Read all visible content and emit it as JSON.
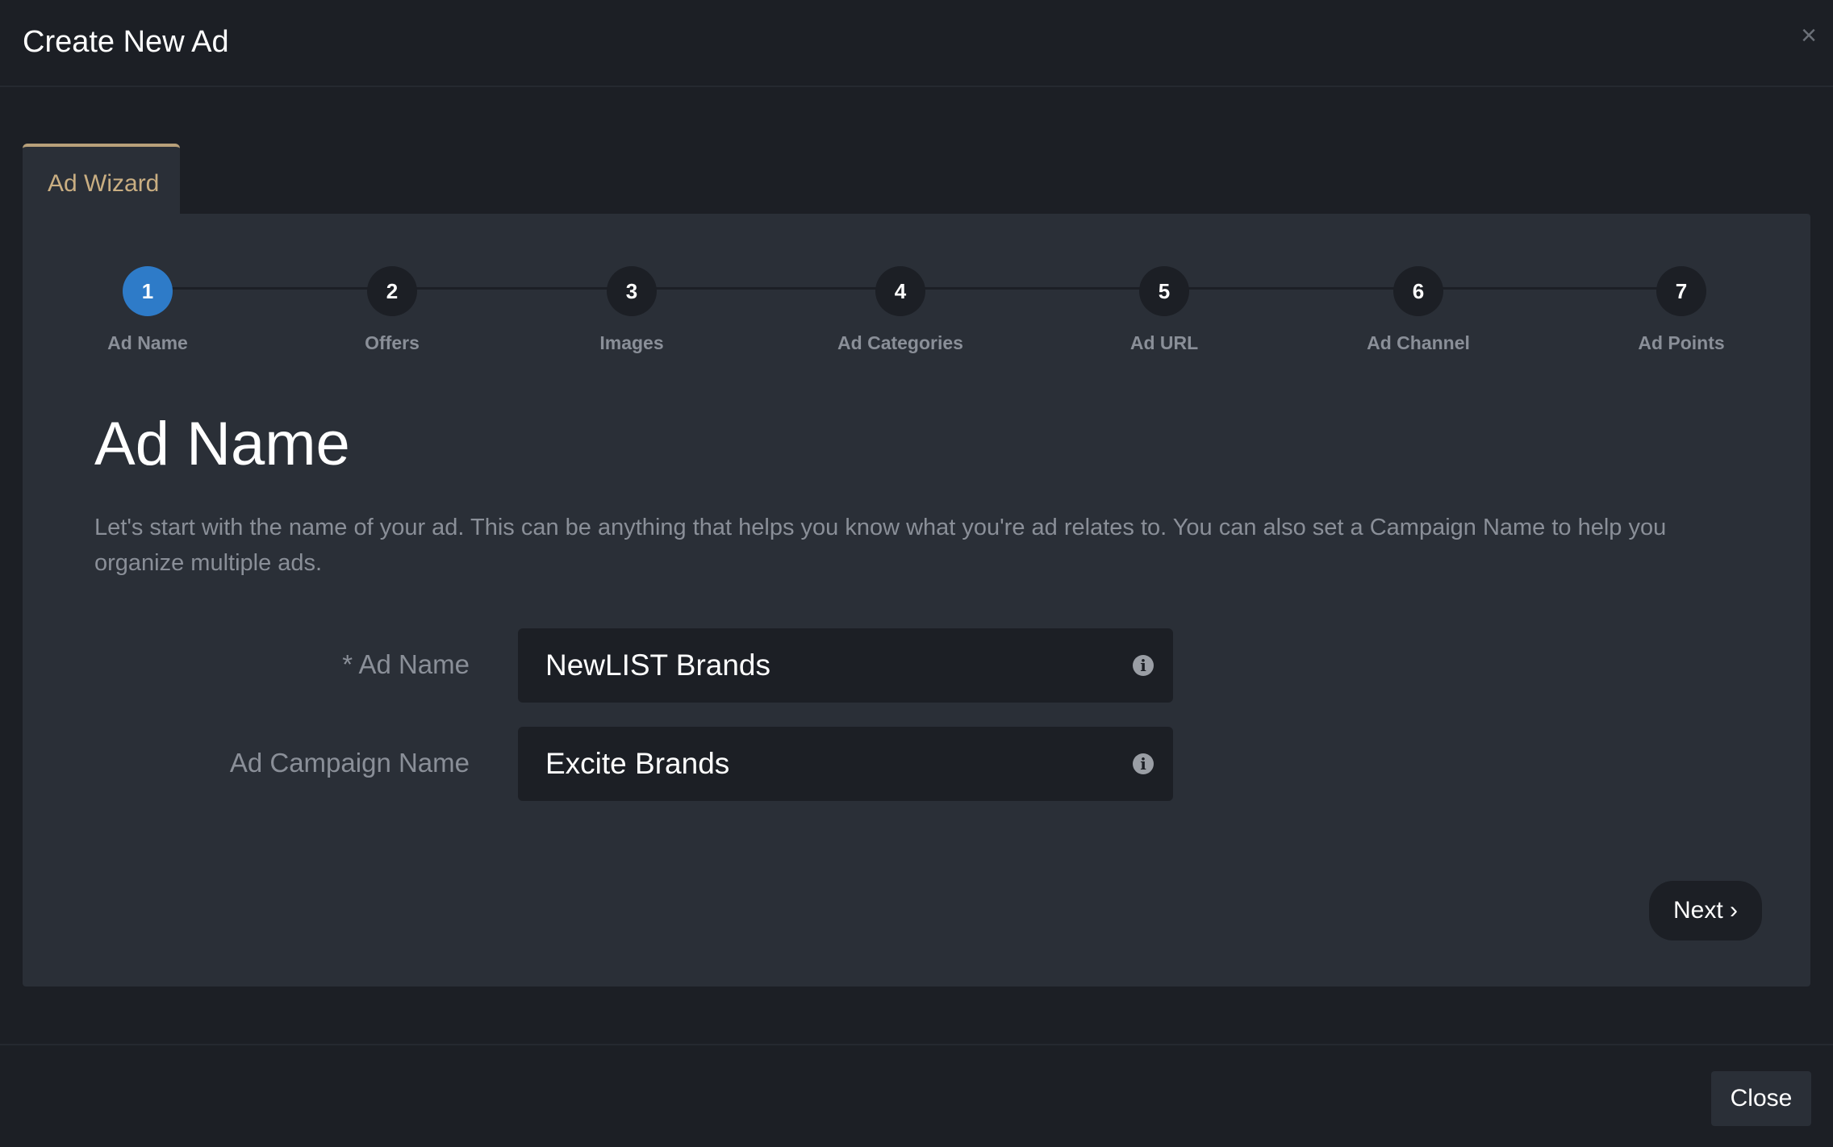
{
  "modal": {
    "title": "Create New Ad",
    "close_icon": "×",
    "close_button_label": "Close"
  },
  "tab": {
    "label": "Ad Wizard"
  },
  "steps": [
    {
      "number": "1",
      "label": "Ad Name",
      "active": true
    },
    {
      "number": "2",
      "label": "Offers",
      "active": false
    },
    {
      "number": "3",
      "label": "Images",
      "active": false
    },
    {
      "number": "4",
      "label": "Ad Categories",
      "active": false
    },
    {
      "number": "5",
      "label": "Ad URL",
      "active": false
    },
    {
      "number": "6",
      "label": "Ad Channel",
      "active": false
    },
    {
      "number": "7",
      "label": "Ad Points",
      "active": false
    }
  ],
  "section": {
    "title": "Ad Name",
    "description": "Let's start with the name of your ad. This can be anything that helps you know what you're ad relates to. You can also set a Campaign Name to help you organize multiple ads."
  },
  "form": {
    "ad_name": {
      "label": "* Ad Name",
      "value": "NewLIST Brands",
      "info_icon": "i"
    },
    "campaign_name": {
      "label": "Ad Campaign Name",
      "value": "Excite Brands",
      "info_icon": "i"
    }
  },
  "next_button": {
    "label": "Next ›"
  },
  "colors": {
    "background": "#1c1f25",
    "panel": "#2a2f37",
    "accent_active": "#2e7bc8",
    "tab_accent": "#c9ae82",
    "muted_text": "#8a8f98"
  }
}
